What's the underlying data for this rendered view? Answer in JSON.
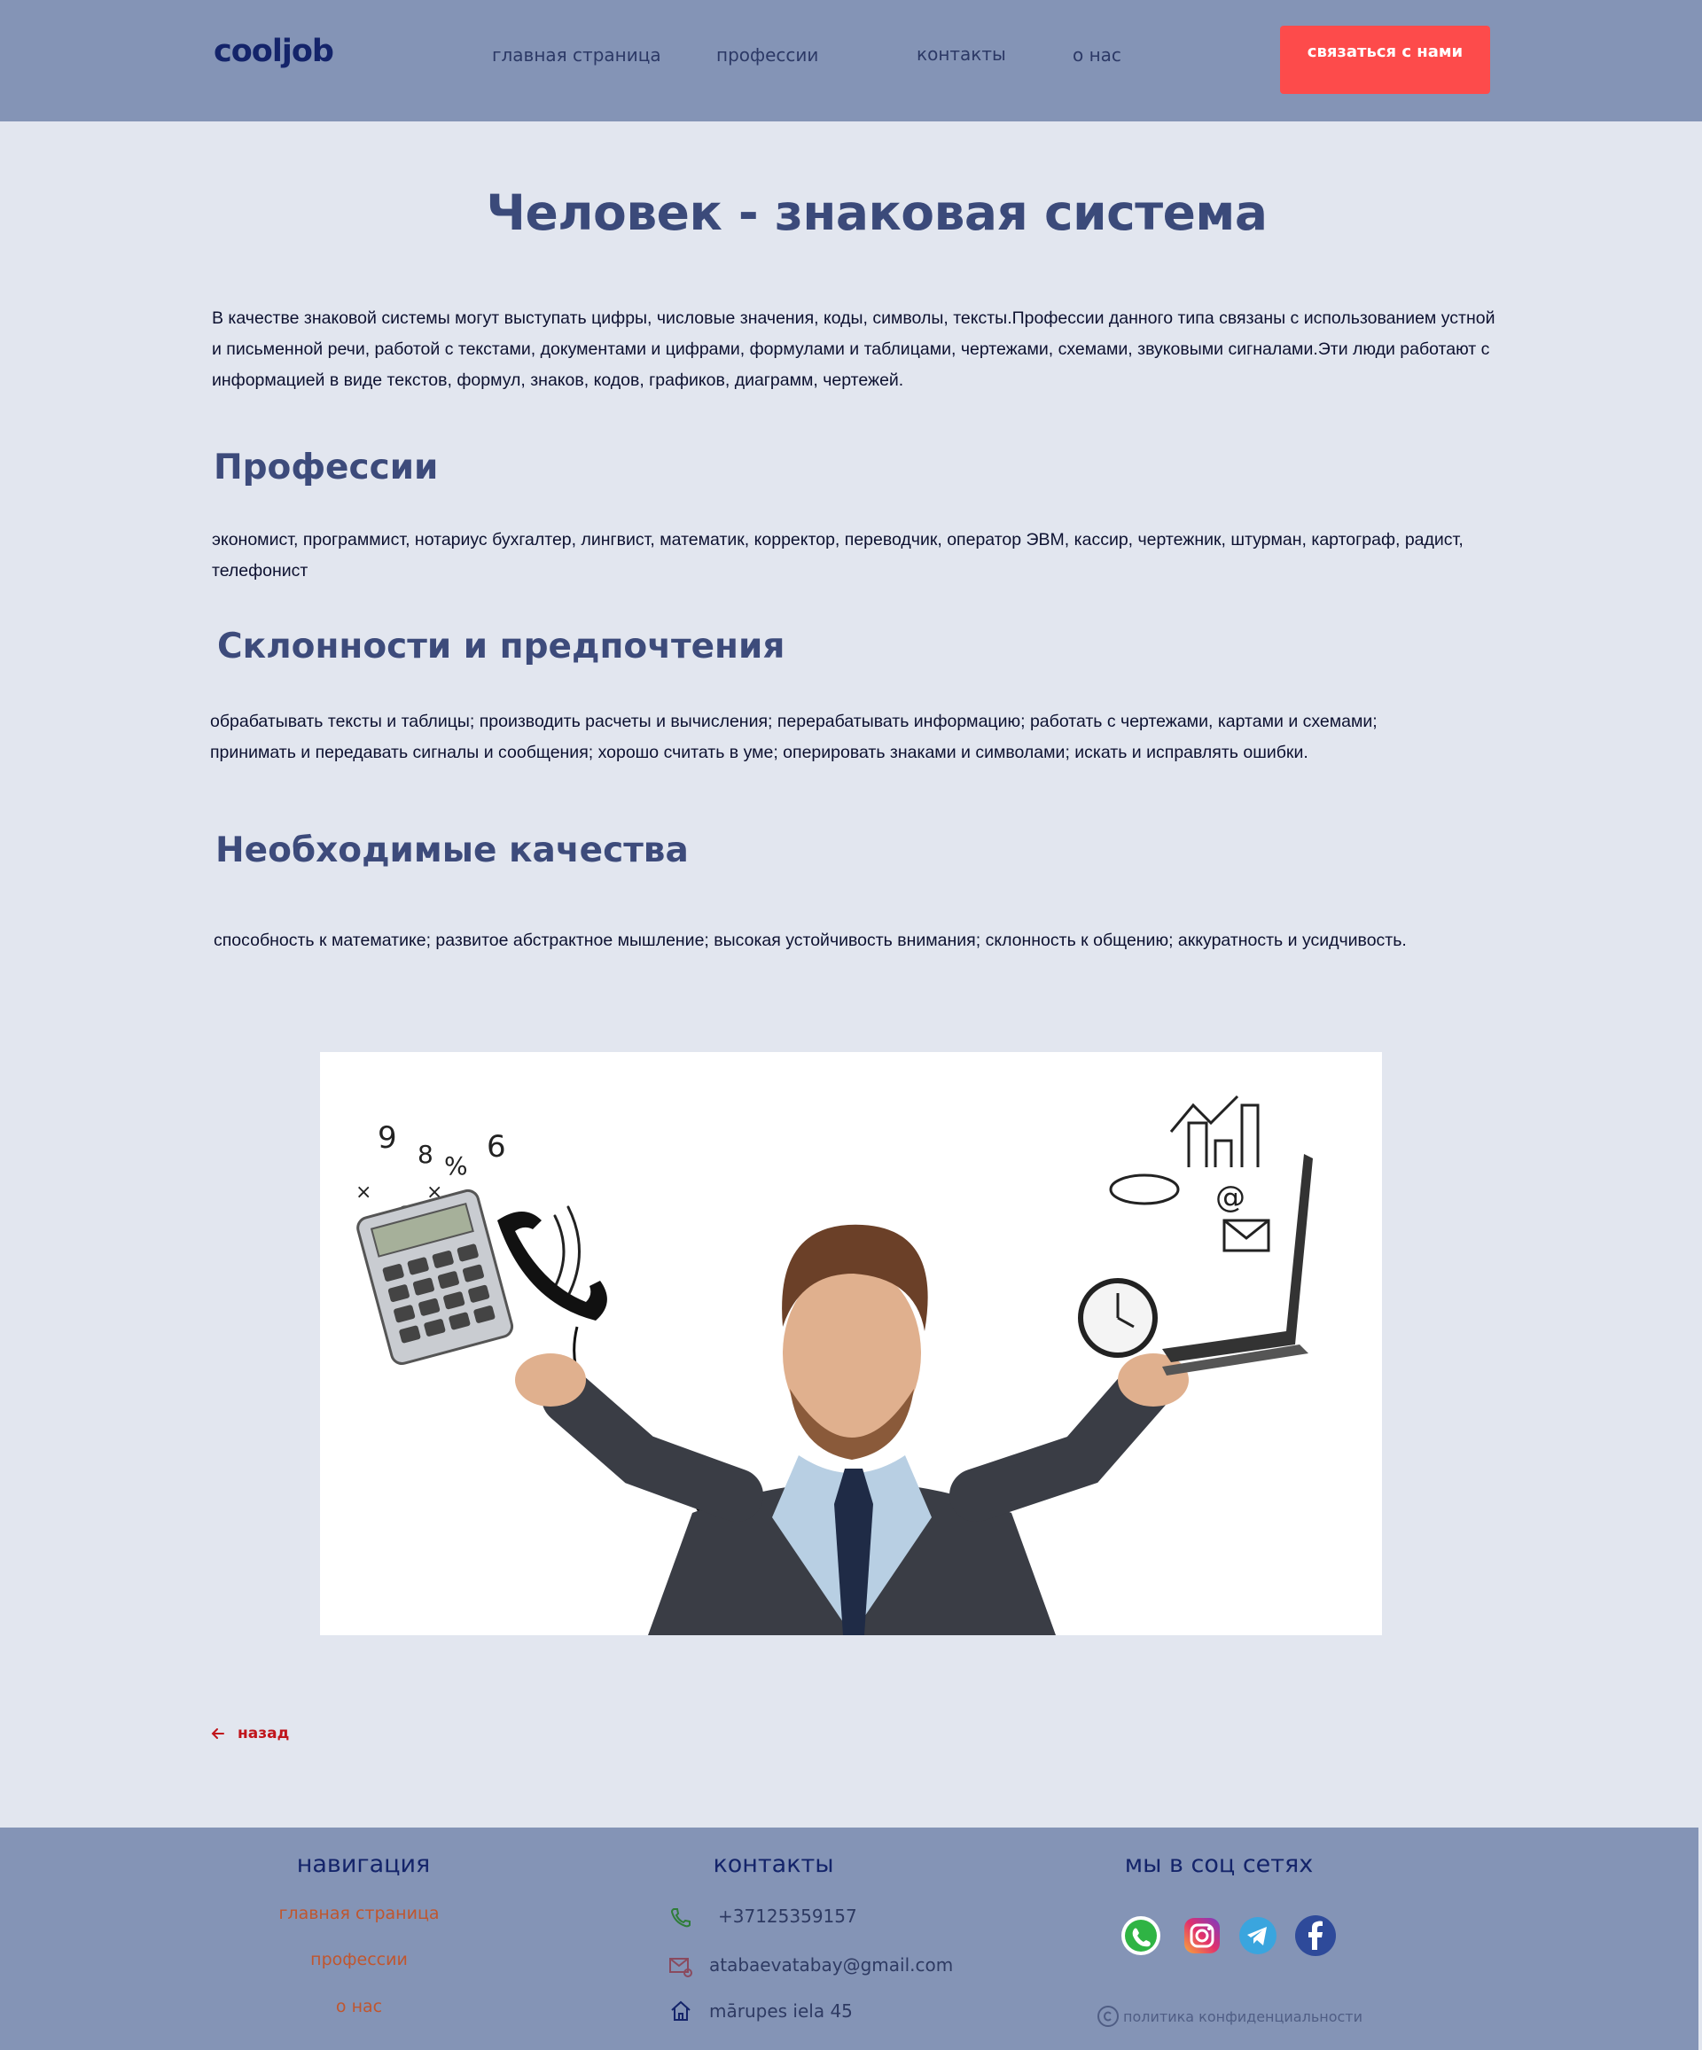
{
  "header": {
    "logo": "cooljob",
    "nav": [
      "главная страница",
      "профессии",
      "контакты",
      "о нас"
    ],
    "cta_label": "связаться с нами"
  },
  "main": {
    "title": "Человек - знаковая система",
    "intro": "В качестве знаковой системы могут выступать цифры, числовые значения, коды, символы, тексты.Профессии данного типа связаны с использованием устной и письменной речи, работой с текстами, документами и цифрами, формулами и таблицами, чертежами, схемами, звуковыми сигналами.Эти люди работают с информацией в виде текстов, формул, знаков, кодов, графиков, диаграмм, чертежей.",
    "sections": [
      {
        "heading": "Профессии",
        "text": "экономист, программист, нотариус бухгалтер, лингвист, математик, корректор, переводчик, оператор ЭВМ, кассир, чертежник, штурман, картограф, радист, телефонист"
      },
      {
        "heading": "Склонности и предпочтения",
        "text": "обрабатывать тексты и таблицы; производить расчеты и вычисления; перерабатывать информацию; работать с чертежами, картами и схемами; принимать и передавать сигналы и сообщения; хорошо считать в уме; оперировать знаками и символами; искать и исправлять ошибки."
      },
      {
        "heading": "Необходимые качества",
        "text": "способность к математике; развитое абстрактное мышление; высокая устойчивость внимания; склонность к общению; аккуратность и усидчивость."
      }
    ],
    "image_icon": "businessman-multitasking-illustration",
    "back_label": "назад"
  },
  "footer": {
    "nav_heading": "навигация",
    "nav_links": [
      "главная страница",
      "профессии",
      "о нас"
    ],
    "contacts_heading": "контакты",
    "phone": "+37125359157",
    "email": "atabaevatabay@gmail.com",
    "address": "mārupes iela 45",
    "social_heading": "мы в соц сетях",
    "social": [
      "whatsapp-icon",
      "instagram-icon",
      "telegram-icon",
      "facebook-icon"
    ],
    "privacy": "политика конфиденциальности"
  },
  "colors": {
    "header_bg": "#8494b6",
    "page_bg": "#e2e6ef",
    "accent": "#fd4b4b",
    "heading": "#3b4a7a"
  }
}
